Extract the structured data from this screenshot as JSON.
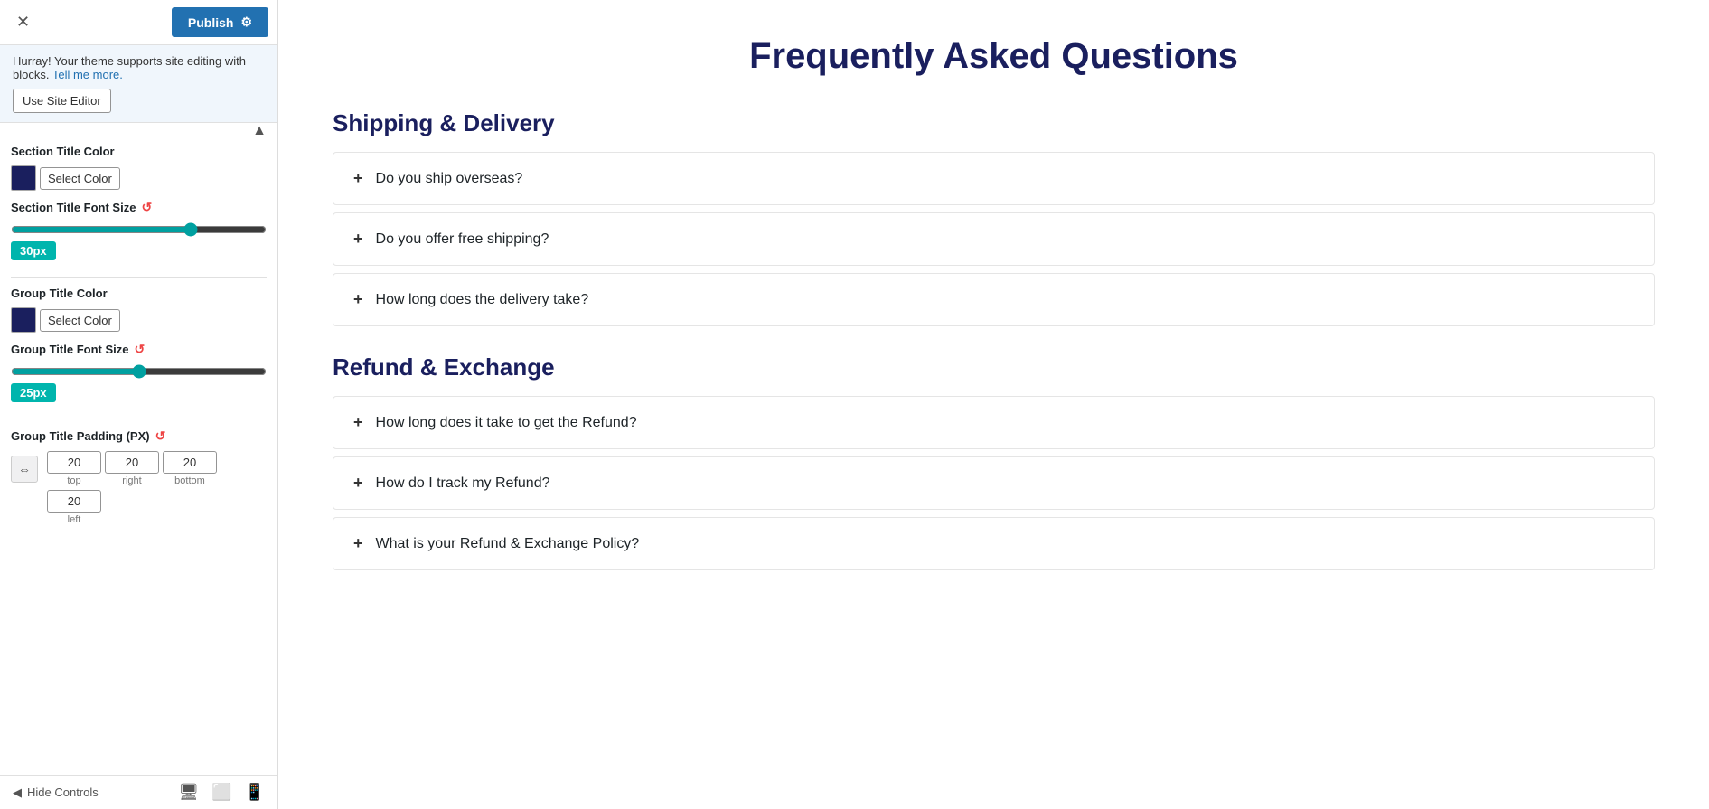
{
  "topbar": {
    "close_label": "✕",
    "publish_label": "Publish",
    "gear_icon": "⚙"
  },
  "notice": {
    "text": "Hurray! Your theme supports site editing with blocks.",
    "link_text": "Tell me more.",
    "button_label": "Use Site Editor"
  },
  "controls": {
    "section_title_color_label": "Section Title Color",
    "section_title_color_btn": "Select Color",
    "section_title_font_size_label": "Section Title Font Size",
    "section_title_reset_icon": "↺",
    "section_title_font_size_value": "30px",
    "section_title_slider_value": 60,
    "group_title_color_label": "Group Title Color",
    "group_title_color_btn": "Select Color",
    "group_title_font_size_label": "Group Title Font Size",
    "group_title_reset_icon": "↺",
    "group_title_font_size_value": "25px",
    "group_title_slider_value": 45,
    "group_title_padding_label": "Group Title Padding (PX)",
    "group_title_padding_reset_icon": "↺",
    "padding_top": "20",
    "padding_right": "20",
    "padding_bottom": "20",
    "padding_left": "20",
    "label_top": "top",
    "label_right": "right",
    "label_bottom": "bottom",
    "label_left": "left"
  },
  "bottom_toolbar": {
    "hide_controls_label": "Hide Controls",
    "hide_icon": "◀",
    "desktop_icon": "🖥",
    "tablet_icon": "⬜",
    "mobile_icon": "📱"
  },
  "faq": {
    "title": "Frequently Asked Questions",
    "sections": [
      {
        "id": "shipping",
        "title": "Shipping & Delivery",
        "items": [
          {
            "question": "Do you ship overseas?"
          },
          {
            "question": "Do you offer free shipping?"
          },
          {
            "question": "How long does the delivery take?"
          }
        ]
      },
      {
        "id": "refund",
        "title": "Refund & Exchange",
        "items": [
          {
            "question": "How long does it take to get the Refund?"
          },
          {
            "question": "How do I track my Refund?"
          },
          {
            "question": "What is your Refund & Exchange Policy?"
          }
        ]
      }
    ]
  }
}
